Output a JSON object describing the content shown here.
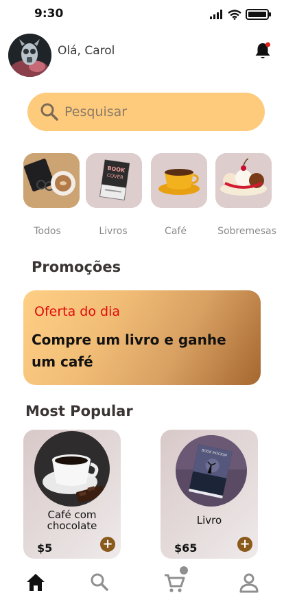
{
  "status": {
    "time": "9:30"
  },
  "header": {
    "greeting": "Olá, Carol"
  },
  "search": {
    "placeholder": "Pesquisar"
  },
  "categories": [
    {
      "label": "Todos"
    },
    {
      "label": "Livros"
    },
    {
      "label": "Café"
    },
    {
      "label": "Sobremesas"
    }
  ],
  "promotions": {
    "title": "Promoções",
    "card": {
      "subtitle": "Oferta do dia",
      "title": "Compre um livro e ganhe um café"
    }
  },
  "popular": {
    "title": "Most Popular",
    "items": [
      {
        "name": "Café com chocolate",
        "price": "$5"
      },
      {
        "name": "Livro",
        "price": "$65"
      }
    ]
  },
  "book_cover_text": "BOOK COVER",
  "book2_cover_text": "BOOK MOCKUP",
  "add_label": "+",
  "colors": {
    "accent": "#fecb7c",
    "promo_sub": "#e00b0b",
    "add_button": "#8a5a1c",
    "category_bg": "#ddcdcd"
  },
  "tabs": [
    {
      "icon": "home-icon",
      "active": true
    },
    {
      "icon": "search-icon",
      "active": false
    },
    {
      "icon": "cart-icon",
      "active": false
    },
    {
      "icon": "profile-icon",
      "active": false
    }
  ]
}
